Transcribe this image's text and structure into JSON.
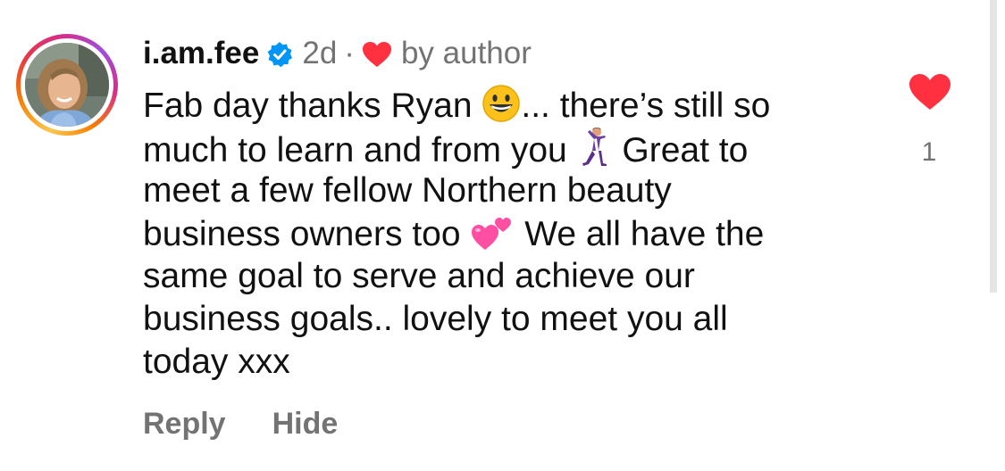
{
  "comment": {
    "username": "i.am.fee",
    "time_ago": "2d",
    "separator": "·",
    "author_like_label": "by author",
    "lines": [
      [
        "Fab day thanks Ryan ",
        "... there’s still so"
      ],
      [
        "much to learn and from you ",
        " Great to"
      ],
      [
        "meet a few fellow Northern beauty"
      ],
      [
        "business owners too ",
        " We all have the"
      ],
      [
        "same goal to serve and achieve our"
      ],
      [
        "business goals.. lovely to meet you all"
      ],
      [
        "today xxx"
      ]
    ],
    "emojis": [
      "grinning-face",
      "man-dancing",
      "two-hearts"
    ]
  },
  "actions": {
    "reply_label": "Reply",
    "hide_label": "Hide"
  },
  "likes": {
    "count": "1",
    "heart_color": "#ff3040"
  },
  "colors": {
    "text": "#111111",
    "secondary": "#737373",
    "verified": "#0095f6",
    "heart": "#ff3040"
  },
  "icons": [
    "avatar",
    "verified-badge-icon",
    "heart-icon"
  ]
}
